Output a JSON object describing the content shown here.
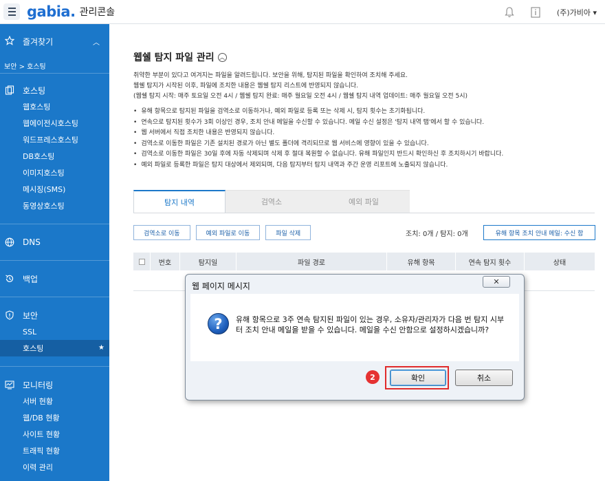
{
  "header": {
    "logo": "gabia.",
    "subtitle": "관리콘솔",
    "user": "(주)가비아 ▾"
  },
  "sidebar": {
    "favorites": "즐겨찾기",
    "breadcrumb": "보안 > 호스팅",
    "sections": [
      {
        "label": "호스팅",
        "icon": "hosting-icon",
        "items": [
          "웹호스팅",
          "웹에이전시호스팅",
          "워드프레스호스팅",
          "DB호스팅",
          "이미지호스팅",
          "메시징(SMS)",
          "동영상호스팅"
        ]
      },
      {
        "label": "DNS",
        "icon": "globe-icon",
        "items": []
      },
      {
        "label": "백업",
        "icon": "backup-icon",
        "items": []
      },
      {
        "label": "보안",
        "icon": "shield-icon",
        "items": [
          "SSL",
          "호스팅"
        ]
      },
      {
        "label": "모니터링",
        "icon": "monitor-icon",
        "items": [
          "서버 현황",
          "웹/DB 현황",
          "사이트 현황",
          "트래픽 현황",
          "이력 관리"
        ]
      }
    ]
  },
  "main": {
    "title": "웹쉘 탐지 파일 관리",
    "desc": [
      "취약한 부분이 있다고 여겨지는 파일을 알려드립니다. 보안을 위해, 탐지된 파일을 확인하여 조치해 주세요.",
      "웹쉘 탐지가 시작된 이후, 파일에 조치한 내용은 웹쉘 탐지 리스트에 반영되지 않습니다.",
      "(웹쉘 탐지 시작: 매주 토요일 오전 4시 / 웹쉘 탐지 완료: 매주 월요일 오전 4시 / 웹쉘 탐지 내역 업데이트: 매주 월요일 오전 5시)"
    ],
    "bullets": [
      "유해 항목으로 탐지된 파일을 검역소로 이동하거나, 예외 파일로 등록 또는 삭제 시, 탐지 횟수는 초기화됩니다.",
      "연속으로 탐지된 횟수가 3회 이상인 경우, 조치 안내 메일을 수신할 수 있습니다. 메일 수신 설정은 '탐지 내역 탭'에서 할 수 있습니다.",
      "웹 서버에서 직접 조치한 내용은 반영되지 않습니다.",
      "검역소로 이동한 파일은 기존 설치된 경로가 아닌 별도 폴더에 격리되므로 웹 서비스에 영향이 있을 수 있습니다.",
      "검역소로 이동한 파일은 30일 후에 자동 삭제되며 삭제 후 절대 복원할 수 없습니다. 유해 파일인지 반드시 확인하신 후 조치하시기 바랍니다.",
      "예외 파일로 등록한 파일은 탐지 대상에서 제외되며, 다음 탐지부터 탐지 내역과 주간 운영 리포트에 노출되지 않습니다."
    ],
    "tabs": [
      "탐지 내역",
      "검역소",
      "예외 파일"
    ],
    "buttons": {
      "quarantine": "검역소로 이동",
      "exception": "예외 파일로 이동",
      "delete": "파일 삭제",
      "mail": "유해 항목 조치 안내 메일: 수신 함"
    },
    "counts": "조치: 0개 / 탐지: 0개",
    "columns": [
      "번호",
      "탐지일",
      "파일 경로",
      "유해 항목",
      "연속 탐지 횟수",
      "상태"
    ]
  },
  "dialog": {
    "title": "웹 페이지 메시지",
    "close": "✕",
    "message": "유해 항목으로 3주 연속 탐지된 파일이 있는 경우, 소유자/관리자가 다음 번 탐지 시부터 조치 안내 메일을 받을 수 있습니다. 메일을 수신 안함으로 설정하시겠습니까?",
    "step": "2",
    "ok": "확인",
    "cancel": "취소"
  }
}
